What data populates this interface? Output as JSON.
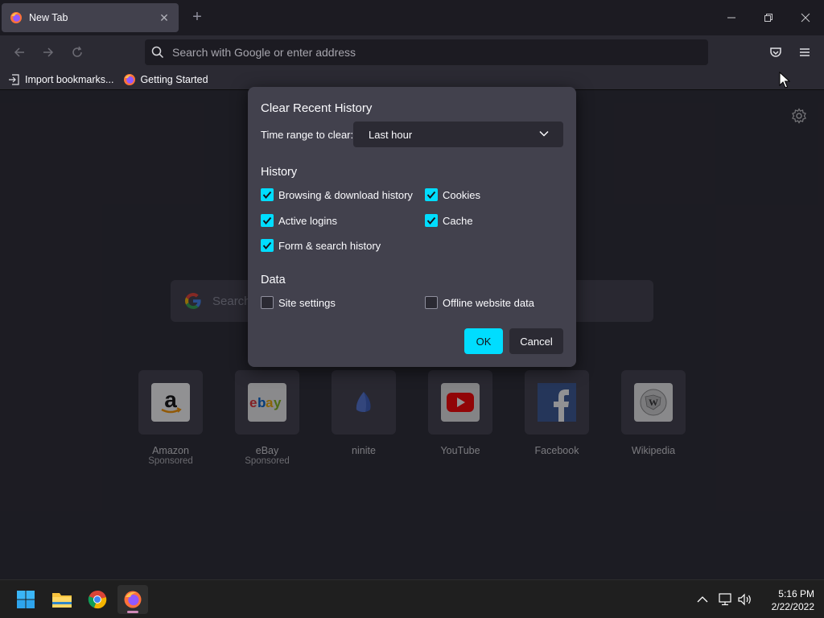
{
  "tab": {
    "title": "New Tab",
    "close_icon": "close-icon"
  },
  "urlbar": {
    "placeholder": "Search with Google or enter address"
  },
  "bookmarks": [
    {
      "label": "Import bookmarks...",
      "icon": "import-icon"
    },
    {
      "label": "Getting Started",
      "icon": "firefox-icon"
    }
  ],
  "newtab": {
    "search_placeholder": "Search",
    "tiles": [
      {
        "label": "Amazon",
        "sub": "Sponsored",
        "icon": "amazon-icon"
      },
      {
        "label": "eBay",
        "sub": "Sponsored",
        "icon": "ebay-icon"
      },
      {
        "label": "ninite",
        "sub": "",
        "icon": "ninite-icon"
      },
      {
        "label": "YouTube",
        "sub": "",
        "icon": "youtube-icon"
      },
      {
        "label": "Facebook",
        "sub": "",
        "icon": "facebook-icon"
      },
      {
        "label": "Wikipedia",
        "sub": "",
        "icon": "wikipedia-icon"
      }
    ]
  },
  "dialog": {
    "title": "Clear Recent History",
    "range_label": "Time range to clear:",
    "range_value": "Last hour",
    "history_heading": "History",
    "history_items": [
      {
        "label": "Browsing & download history",
        "checked": true
      },
      {
        "label": "Cookies",
        "checked": true
      },
      {
        "label": "Active logins",
        "checked": true
      },
      {
        "label": "Cache",
        "checked": true
      },
      {
        "label": "Form & search history",
        "checked": true
      }
    ],
    "data_heading": "Data",
    "data_items": [
      {
        "label": "Site settings",
        "checked": false
      },
      {
        "label": "Offline website data",
        "checked": false
      }
    ],
    "ok_label": "OK",
    "cancel_label": "Cancel"
  },
  "taskbar": {
    "time": "5:16 PM",
    "date": "2/22/2022"
  },
  "colors": {
    "accent": "#00ddff",
    "dialog_bg": "#42414d",
    "page_bg": "#2b2a33"
  }
}
